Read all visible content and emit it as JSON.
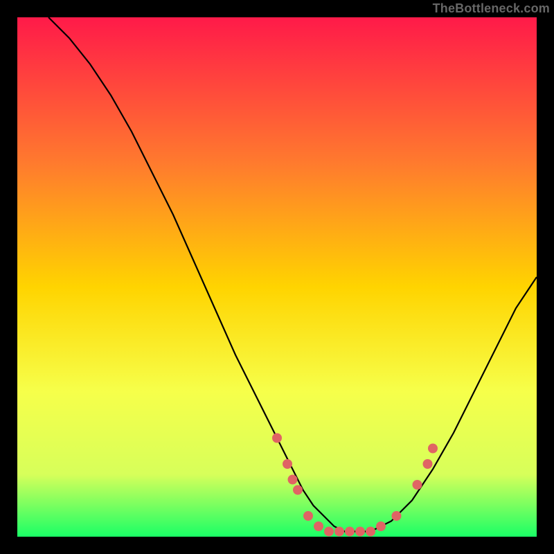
{
  "watermark": "TheBottleneck.com",
  "chart_data": {
    "type": "line",
    "title": "",
    "xlabel": "",
    "ylabel": "",
    "xlim": [
      0,
      100
    ],
    "ylim": [
      0,
      100
    ],
    "gradient_colors": {
      "top": "#ff1a49",
      "mid_upper": "#ff7a2e",
      "mid": "#ffd400",
      "mid_lower": "#f6ff4a",
      "lower": "#d7ff5a",
      "bottom": "#1aff66"
    },
    "curve": {
      "name": "bottleneck-curve",
      "x": [
        6,
        10,
        14,
        18,
        22,
        26,
        30,
        34,
        38,
        42,
        46,
        50,
        53,
        55,
        57,
        59,
        61,
        63,
        65,
        68,
        72,
        76,
        80,
        84,
        88,
        92,
        96,
        100
      ],
      "y": [
        100,
        96,
        91,
        85,
        78,
        70,
        62,
        53,
        44,
        35,
        27,
        19,
        13,
        9,
        6,
        4,
        2,
        1,
        1,
        1,
        3,
        7,
        13,
        20,
        28,
        36,
        44,
        50
      ]
    },
    "markers": {
      "name": "highlight-points",
      "color": "#e06464",
      "points": [
        {
          "x": 50,
          "y": 19
        },
        {
          "x": 52,
          "y": 14
        },
        {
          "x": 53,
          "y": 11
        },
        {
          "x": 54,
          "y": 9
        },
        {
          "x": 56,
          "y": 4
        },
        {
          "x": 58,
          "y": 2
        },
        {
          "x": 60,
          "y": 1
        },
        {
          "x": 62,
          "y": 1
        },
        {
          "x": 64,
          "y": 1
        },
        {
          "x": 66,
          "y": 1
        },
        {
          "x": 68,
          "y": 1
        },
        {
          "x": 70,
          "y": 2
        },
        {
          "x": 73,
          "y": 4
        },
        {
          "x": 77,
          "y": 10
        },
        {
          "x": 79,
          "y": 14
        },
        {
          "x": 80,
          "y": 17
        }
      ]
    }
  }
}
